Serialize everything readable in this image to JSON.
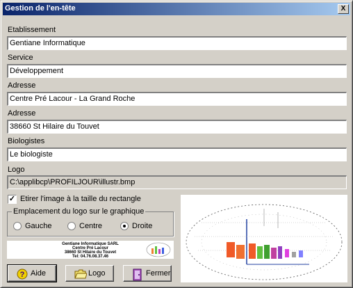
{
  "window": {
    "title": "Gestion de l'en-tête",
    "close_glyph": "X"
  },
  "fields": {
    "etablissement": {
      "label": "Etablissement",
      "value": "Gentiane Informatique"
    },
    "service": {
      "label": "Service",
      "value": "Développement"
    },
    "adresse1": {
      "label": "Adresse",
      "value": "Centre Pré Lacour - La Grand Roche"
    },
    "adresse2": {
      "label": "Adresse",
      "value": "38660 St Hilaire du Touvet"
    },
    "biologistes": {
      "label": "Biologistes",
      "value": "Le biologiste"
    },
    "logo": {
      "label": "Logo",
      "value": "C:\\applibcp\\PROFILJOUR\\illustr.bmp"
    }
  },
  "stretch": {
    "label": "Etirer l'image à la taille du rectangle",
    "checked": true,
    "check_glyph": "✓"
  },
  "placement": {
    "title": "Emplacement du logo sur le graphique",
    "options": [
      {
        "label": "Gauche",
        "selected": false
      },
      {
        "label": "Centre",
        "selected": false
      },
      {
        "label": "Droite",
        "selected": true
      }
    ]
  },
  "logo_preview": {
    "lines": [
      "Gentiane Informatique SARL",
      "Centre Pré Lacour",
      "38660 St Hilaire du Touvet",
      "Tel: 04.76.08.37.46"
    ]
  },
  "buttons": {
    "aide": {
      "label": "Aide",
      "icon": "help-icon"
    },
    "logo": {
      "label": "Logo",
      "icon": "folder-icon"
    },
    "fermer": {
      "label": "Fermer",
      "icon": "door-exit-icon"
    }
  },
  "colors": {
    "titlebar_start": "#0a246a",
    "titlebar_end": "#a6caf0",
    "face": "#d4d0c8"
  }
}
